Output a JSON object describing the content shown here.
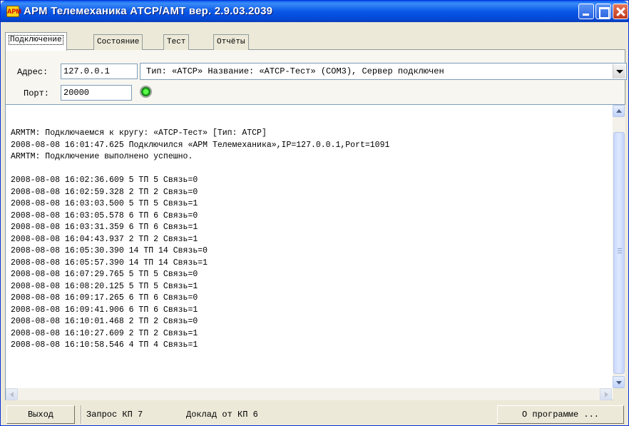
{
  "window": {
    "title": "АРМ Телемеханика АТСР/АМТ вер. 2.9.03.2039",
    "icon": "app-logo-icon"
  },
  "tabs": [
    {
      "label": "Подключение",
      "active": true
    },
    {
      "label": "Состояние",
      "active": false
    },
    {
      "label": "Тест",
      "active": false
    },
    {
      "label": "Отчёты",
      "active": false
    }
  ],
  "connection": {
    "address_label": "Адрес:",
    "address_value": "127.0.0.1",
    "port_label": "Порт:",
    "port_value": "20000",
    "server_select_value": "Тип: «АТСР» Название: «АТСР-Тест»  (COM3), Сервер подключен",
    "led_color": "#2dbb25"
  },
  "log": {
    "lines": [
      "ARMTM: Подключаемся к кругу: «АТСР-Тест» [Тип: АТСР]",
      "2008-08-08 16:01:47.625 Подключился «АРМ Телемеханика»,IP=127.0.0.1,Port=1091",
      "ARMTM: Подключение выполнено успешно.",
      "",
      "2008-08-08 16:02:36.609 5 ТП 5 Связь=0",
      "2008-08-08 16:02:59.328 2 ТП 2 Связь=0",
      "2008-08-08 16:03:03.500 5 ТП 5 Связь=1",
      "2008-08-08 16:03:05.578 6 ТП 6 Связь=0",
      "2008-08-08 16:03:31.359 6 ТП 6 Связь=1",
      "2008-08-08 16:04:43.937 2 ТП 2 Связь=1",
      "2008-08-08 16:05:30.390 14 ТП 14 Связь=0",
      "2008-08-08 16:05:57.390 14 ТП 14 Связь=1",
      "2008-08-08 16:07:29.765 5 ТП 5 Связь=0",
      "2008-08-08 16:08:20.125 5 ТП 5 Связь=1",
      "2008-08-08 16:09:17.265 6 ТП 6 Связь=0",
      "2008-08-08 16:09:41.906 6 ТП 6 Связь=1",
      "2008-08-08 16:10:01.468 2 ТП 2 Связь=0",
      "2008-08-08 16:10:27.609 2 ТП 2 Связь=1",
      "2008-08-08 16:10:58.546 4 ТП 4 Связь=1"
    ]
  },
  "statusbar": {
    "exit_label": "Выход",
    "request_text": "Запрос КП 7",
    "report_text": "Доклад от КП 6",
    "about_label": "О программе ..."
  },
  "colors": {
    "titlebar": "#0a58e8",
    "window_bg": "#ece9d8"
  }
}
